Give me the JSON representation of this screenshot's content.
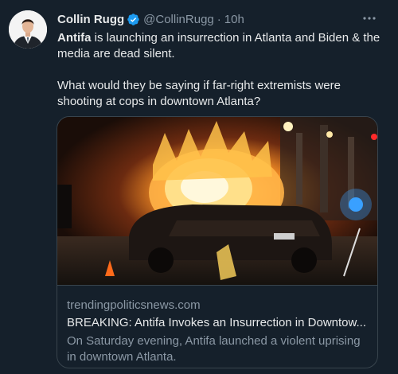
{
  "tweet": {
    "author": {
      "display_name": "Collin Rugg",
      "handle": "@CollinRugg",
      "verified": true
    },
    "separator": "·",
    "timestamp": "10h",
    "text": {
      "line1_highlight": "Antifa",
      "line1_rest": " is launching an insurrection in Atlanta and Biden & the media are dead silent.",
      "line2": "What would they be saying if far-right extremists were shooting at cops in downtown Atlanta?"
    },
    "card": {
      "domain": "trendingpoliticsnews.com",
      "title": "BREAKING: Antifa Invokes an Insurrection in Downtow...",
      "description": "On Saturday evening, Antifa launched a violent uprising in downtown Atlanta."
    }
  },
  "icons": {
    "verified": "verified-badge-icon",
    "more": "more-options-icon"
  },
  "colors": {
    "background": "#15202b",
    "primary_text": "#e7e9ea",
    "secondary_text": "#8b98a5",
    "verified_blue": "#1d9bf0",
    "border": "#38444d"
  }
}
